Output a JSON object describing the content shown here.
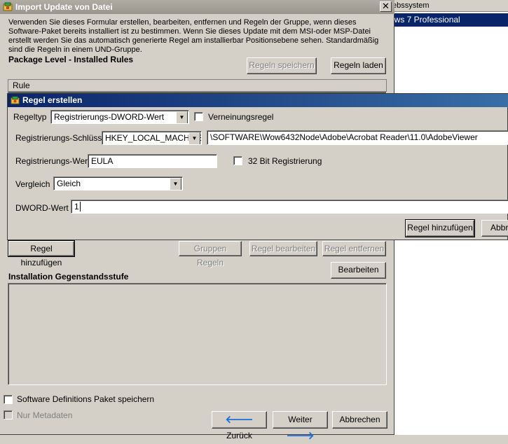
{
  "background_window": {
    "column_header": "ebssystem",
    "selected_row": "ows 7 Professional"
  },
  "dialog": {
    "title": "Import Update von Datei",
    "close_glyph": "✕",
    "description": "Verwenden Sie dieses Formular erstellen, bearbeiten, entfernen und Regeln der Gruppe, wenn dieses Software-Paket bereits installiert ist zu bestimmen. Wenn Sie dieses Update mit dem MSI-oder MSP-Datei erstellt werden Sie das automatisch generierte Regel am installierbar Positionsebene sehen. Standardmäßig sind die Regeln in einem UND-Gruppe.",
    "package_level_title": "Package Level - Installed Rules",
    "save_rules": "Regeln speichern",
    "load_rules": "Regeln laden",
    "rule_column": "Rule",
    "add_rule": "Regel hinzufügen",
    "group_rules": "Gruppen Regeln",
    "edit_rule": "Regel bearbeiten",
    "remove_rule": "Regel entfernen",
    "edit": "Bearbeiten",
    "installation_level_title": "Installation Gegenstandsstufe",
    "save_package_label": "Software Definitions Paket speichern",
    "metadata_only_label": "Nur Metadaten",
    "back": "Zurück",
    "next": "Weiter",
    "cancel": "Abbrechen"
  },
  "regel_dialog": {
    "title": "Regel erstellen",
    "rule_type_label": "Regeltyp",
    "rule_type_value": "Registrierungs-DWORD-Wert",
    "negation_label": "Verneinungsregel",
    "key_label": "Registrierungs-Schlüssel",
    "hive_value": "HKEY_LOCAL_MACHINE",
    "key_path": "\\SOFTWARE\\Wow6432Node\\Adobe\\Acrobat Reader\\11.0\\AdobeViewer",
    "value_label": "Registrierungs-Wert",
    "value_value": "EULA",
    "bit32_label": "32 Bit Registrierung",
    "compare_label": "Vergleich",
    "compare_value": "Gleich",
    "dword_label": "DWORD-Wert",
    "dword_value": "1",
    "add_rule": "Regel hinzufügen",
    "cancel_partial": "Abbre"
  },
  "colors": {
    "dialog_bg": "#d4d0c8",
    "active_title": "#0a246a",
    "selection": "#0a246a",
    "arrow_blue": "#1e6fd9"
  }
}
